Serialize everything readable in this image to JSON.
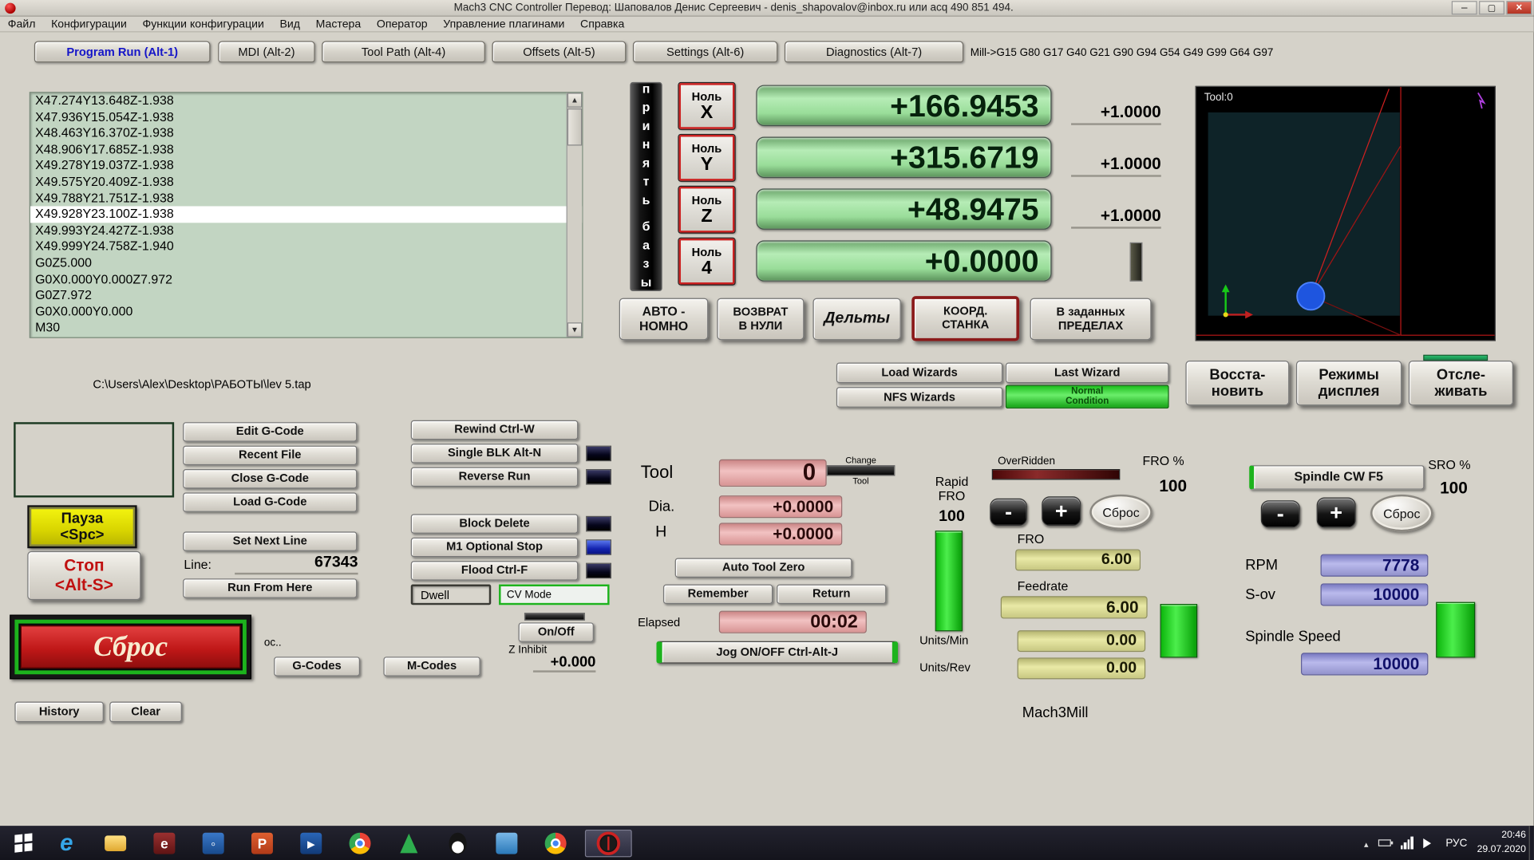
{
  "window": {
    "title": "Mach3 CNC Controller Перевод: Шаповалов Денис Сергеевич - denis_shapovalov@inbox.ru или acq 490 851 494."
  },
  "menu": {
    "items": [
      "Файл",
      "Конфигурации",
      "Функции конфигурации",
      "Вид",
      "Мастера",
      "Оператор",
      "Управление плагинами",
      "Справка"
    ]
  },
  "tabs": {
    "items": [
      "Program Run (Alt-1)",
      "MDI (Alt-2)",
      "Tool Path (Alt-4)",
      "Offsets (Alt-5)",
      "Settings (Alt-6)",
      "Diagnostics (Alt-7)"
    ],
    "gcode_modes": "Mill->G15  G80 G17 G40 G21 G90 G94 G54 G49 G99 G64 G97"
  },
  "gcode": {
    "lines": [
      "X47.274Y13.648Z-1.938",
      "X47.936Y15.054Z-1.938",
      "X48.463Y16.370Z-1.938",
      "X48.906Y17.685Z-1.938",
      "X49.278Y19.037Z-1.938",
      "X49.575Y20.409Z-1.938",
      "X49.788Y21.751Z-1.938",
      "X49.928Y23.100Z-1.938",
      "X49.993Y24.427Z-1.938",
      "X49.999Y24.758Z-1.940",
      "G0Z5.000",
      "G0X0.000Y0.000Z7.972",
      "G0Z7.972",
      "G0X0.000Y0.000",
      "M30"
    ],
    "highlight_index": 7,
    "file_path": "C:\\Users\\Alex\\Desktop\\РАБОТЫ\\lev 5.tap"
  },
  "dro": {
    "accept_word1": "принять",
    "accept_word2": "базы",
    "zero_label": "Ноль",
    "axes": [
      {
        "name": "X",
        "value": "+166.9453",
        "scale": "+1.0000"
      },
      {
        "name": "Y",
        "value": "+315.6719",
        "scale": "+1.0000"
      },
      {
        "name": "Z",
        "value": "+48.9475",
        "scale": "+1.0000"
      },
      {
        "name": "4",
        "value": "+0.0000",
        "scale": ""
      }
    ],
    "ref_all_line1": "АВТО -",
    "ref_all_line2": "НОМНО",
    "goto_z_line1": "ВОЗВРАТ",
    "goto_z_line2": "В НУЛИ",
    "deltas": "Дельты",
    "machine_line1": "КООРД.",
    "machine_line2": "СТАНКА",
    "limits_line1": "В заданных",
    "limits_line2": "ПРЕДЕЛАХ"
  },
  "toolpath": {
    "tool_label": "Tool:0"
  },
  "wizards": {
    "load": "Load Wizards",
    "last": "Last Wizard",
    "nfs": "NFS Wizards",
    "status_line1": "Normal",
    "status_line2": "Condition"
  },
  "display": {
    "regen_line1": "Восста-",
    "regen_line2": "новить",
    "modes_line1": "Режимы",
    "modes_line2": "дисплея",
    "follow_line1": "Отсле-",
    "follow_line2": "живать"
  },
  "file_ops": {
    "edit": "Edit G-Code",
    "recent": "Recent File",
    "close": "Close G-Code",
    "load": "Load G-Code",
    "set_next": "Set Next Line",
    "line_label": "Line:",
    "line_value": "67343",
    "run_from_here": "Run From Here"
  },
  "cycle": {
    "pause_line1": "Пауза",
    "pause_line2": "<Spc>",
    "stop_line1": "Стоп",
    "stop_line2": "<Alt-S>",
    "reset": "Сброс",
    "os_label": "ос..",
    "gcodes": "G-Codes",
    "mcodes": "M-Codes",
    "history": "History",
    "clear": "Clear"
  },
  "run_opts": {
    "rewind": "Rewind Ctrl-W",
    "single_blk": "Single BLK Alt-N",
    "reverse": "Reverse Run",
    "block_delete": "Block Delete",
    "m1_stop": "M1 Optional Stop",
    "flood": "Flood Ctrl-F",
    "dwell": "Dwell",
    "cv_mode": "CV Mode",
    "on_off": "On/Off",
    "z_inhibit_label": "Z Inhibit",
    "z_inhibit_value": "+0.000"
  },
  "tool": {
    "label": "Tool",
    "number": "0",
    "change_line1": "Change",
    "change_line2": "Tool",
    "dia_label": "Dia.",
    "dia_value": "+0.0000",
    "h_label": "H",
    "h_value": "+0.0000",
    "auto_zero": "Auto Tool Zero",
    "remember": "Remember",
    "return_btn": "Return",
    "elapsed_label": "Elapsed",
    "elapsed_value": "00:02",
    "jog": "Jog ON/OFF Ctrl-Alt-J"
  },
  "feed": {
    "rapid_line1": "Rapid",
    "rapid_line2": "FRO",
    "rapid_value": "100",
    "overridden": "OverRidden",
    "fro_pct_label": "FRO %",
    "fro_pct_value": "100",
    "minus": "-",
    "plus": "+",
    "reset": "Сброс",
    "fro_label": "FRO",
    "fro_value": "6.00",
    "feedrate_label": "Feedrate",
    "feedrate_value": "6.00",
    "units_min_label": "Units/Min",
    "units_min_value": "0.00",
    "units_rev_label": "Units/Rev",
    "units_rev_value": "0.00",
    "profile": "Mach3Mill"
  },
  "spindle": {
    "toggle": "Spindle CW F5",
    "sro_label": "SRO %",
    "sro_value": "100",
    "minus": "-",
    "plus": "+",
    "reset": "Сброс",
    "rpm_label": "RPM",
    "rpm_value": "7778",
    "sov_label": "S-ov",
    "sov_value": "10000",
    "speed_label": "Spindle Speed",
    "speed_value": "10000"
  },
  "taskbar": {
    "lang": "РУС",
    "time": "20:46",
    "date": "29.07.2020",
    "icons": [
      "start",
      "internet-explorer",
      "file-explorer",
      "app-maroon",
      "app-network",
      "powerpoint",
      "app-media",
      "chrome",
      "vlc-green",
      "penguin",
      "app-viewer",
      "chrome-2",
      "mach3"
    ]
  },
  "colors": {
    "dro_green": "#9ade9a",
    "value_pink": "#e8b0b0",
    "value_khaki": "#e0e098",
    "value_purple": "#a8a8dc",
    "accent_green": "#1db31d",
    "reset_red": "#c01818",
    "pause_yellow": "#e8e410"
  }
}
